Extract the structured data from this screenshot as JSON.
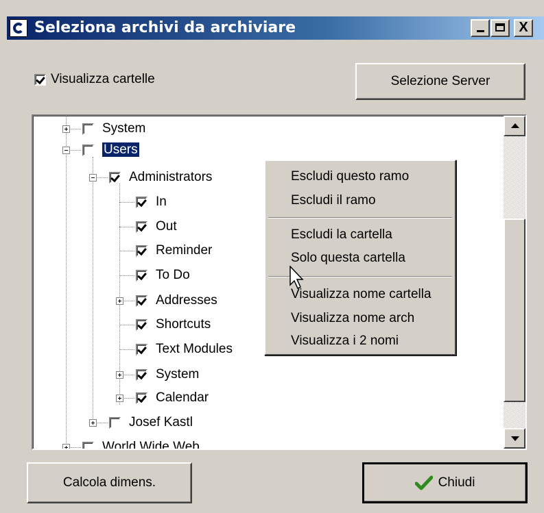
{
  "window": {
    "title": "Seleziona archivi da archiviare"
  },
  "titlebar_buttons": {
    "close": "X"
  },
  "options": {
    "show_folders_label": "Visualizza cartelle",
    "show_folders_checked": true
  },
  "buttons": {
    "select_server": "Selezione Server",
    "calc_size": "Calcola dimens.",
    "close": "Chiudi"
  },
  "tree": {
    "nodes": [
      {
        "label": "System",
        "checked": false,
        "expander": "plus"
      },
      {
        "label": "Users",
        "checked": false,
        "expander": "minus",
        "selected": true
      },
      {
        "label": "Administrators",
        "checked": true,
        "expander": "minus"
      },
      {
        "label": "In",
        "checked": true
      },
      {
        "label": "Out",
        "checked": true
      },
      {
        "label": "Reminder",
        "checked": true
      },
      {
        "label": "To Do",
        "checked": true
      },
      {
        "label": "Addresses",
        "checked": true,
        "expander": "plus"
      },
      {
        "label": "Shortcuts",
        "checked": true
      },
      {
        "label": "Text Modules",
        "checked": true
      },
      {
        "label": "System",
        "checked": true,
        "expander": "plus"
      },
      {
        "label": "Calendar",
        "checked": true,
        "expander": "plus"
      },
      {
        "label": "Josef Kastl",
        "checked": false,
        "expander": "plus"
      },
      {
        "label": "World Wide Web",
        "checked": false,
        "expander": "plus"
      }
    ]
  },
  "context_menu": {
    "items": [
      "Escludi questo ramo",
      "Escludi il ramo",
      "Escludi la cartella",
      "Solo questa cartella",
      "Visualizza nome cartella",
      "Visualizza nome arch",
      "Visualizza i 2 nomi"
    ]
  },
  "colors": {
    "titlebar": "#0a246a",
    "selection": "#0a246a",
    "face": "#d4d0c8",
    "check_green": "#2e8b1e"
  }
}
